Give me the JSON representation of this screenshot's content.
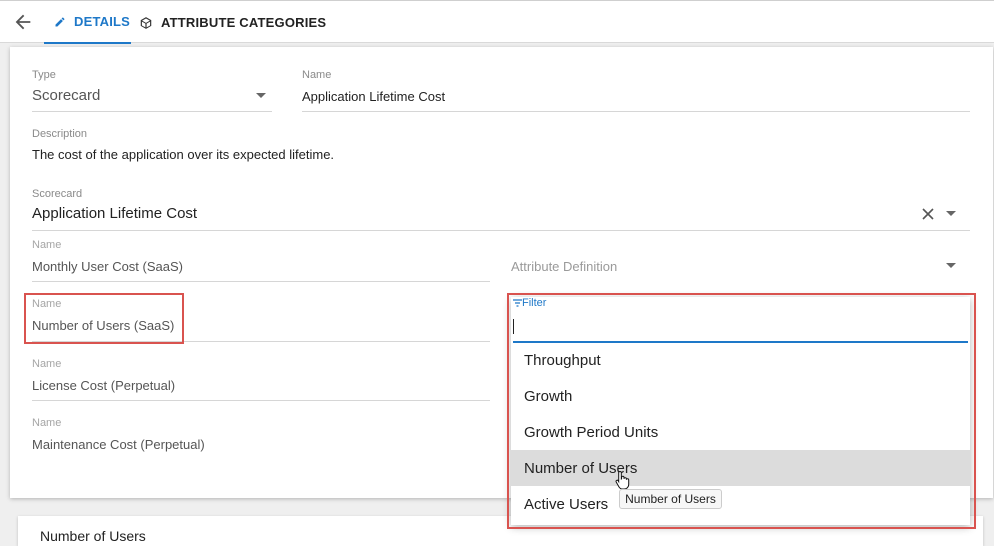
{
  "tabs": [
    {
      "label": "DETAILS",
      "icon": "pencil-icon",
      "active": true
    },
    {
      "label": "ATTRIBUTE CATEGORIES",
      "icon": "cube-icon",
      "active": false
    }
  ],
  "form": {
    "type": {
      "label": "Type",
      "value": "Scorecard"
    },
    "name": {
      "label": "Name",
      "value": "Application Lifetime Cost"
    },
    "description": {
      "label": "Description",
      "value": "The cost of the application over its expected lifetime."
    },
    "scorecard": {
      "label": "Scorecard",
      "value": "Application Lifetime Cost"
    },
    "rows": [
      {
        "label": "Name",
        "value": "Monthly User Cost (SaaS)"
      },
      {
        "label": "Name",
        "value": "Number of Users (SaaS)"
      },
      {
        "label": "Name",
        "value": "License Cost (Perpetual)"
      },
      {
        "label": "Name",
        "value": "Maintenance Cost (Perpetual)"
      }
    ],
    "attribute_definition": {
      "placeholder": "Attribute Definition"
    }
  },
  "dropdown": {
    "filter_label": "Filter",
    "filter_value": "",
    "options": [
      "Throughput",
      "Growth",
      "Growth Period Units",
      "Number of Users",
      "Active Users"
    ],
    "selected": "Number of Users"
  },
  "tooltip": "Number of Users",
  "lower_card_title": "Number of Users",
  "colors": {
    "accent": "#1e78c8",
    "highlight": "#d9534f"
  }
}
